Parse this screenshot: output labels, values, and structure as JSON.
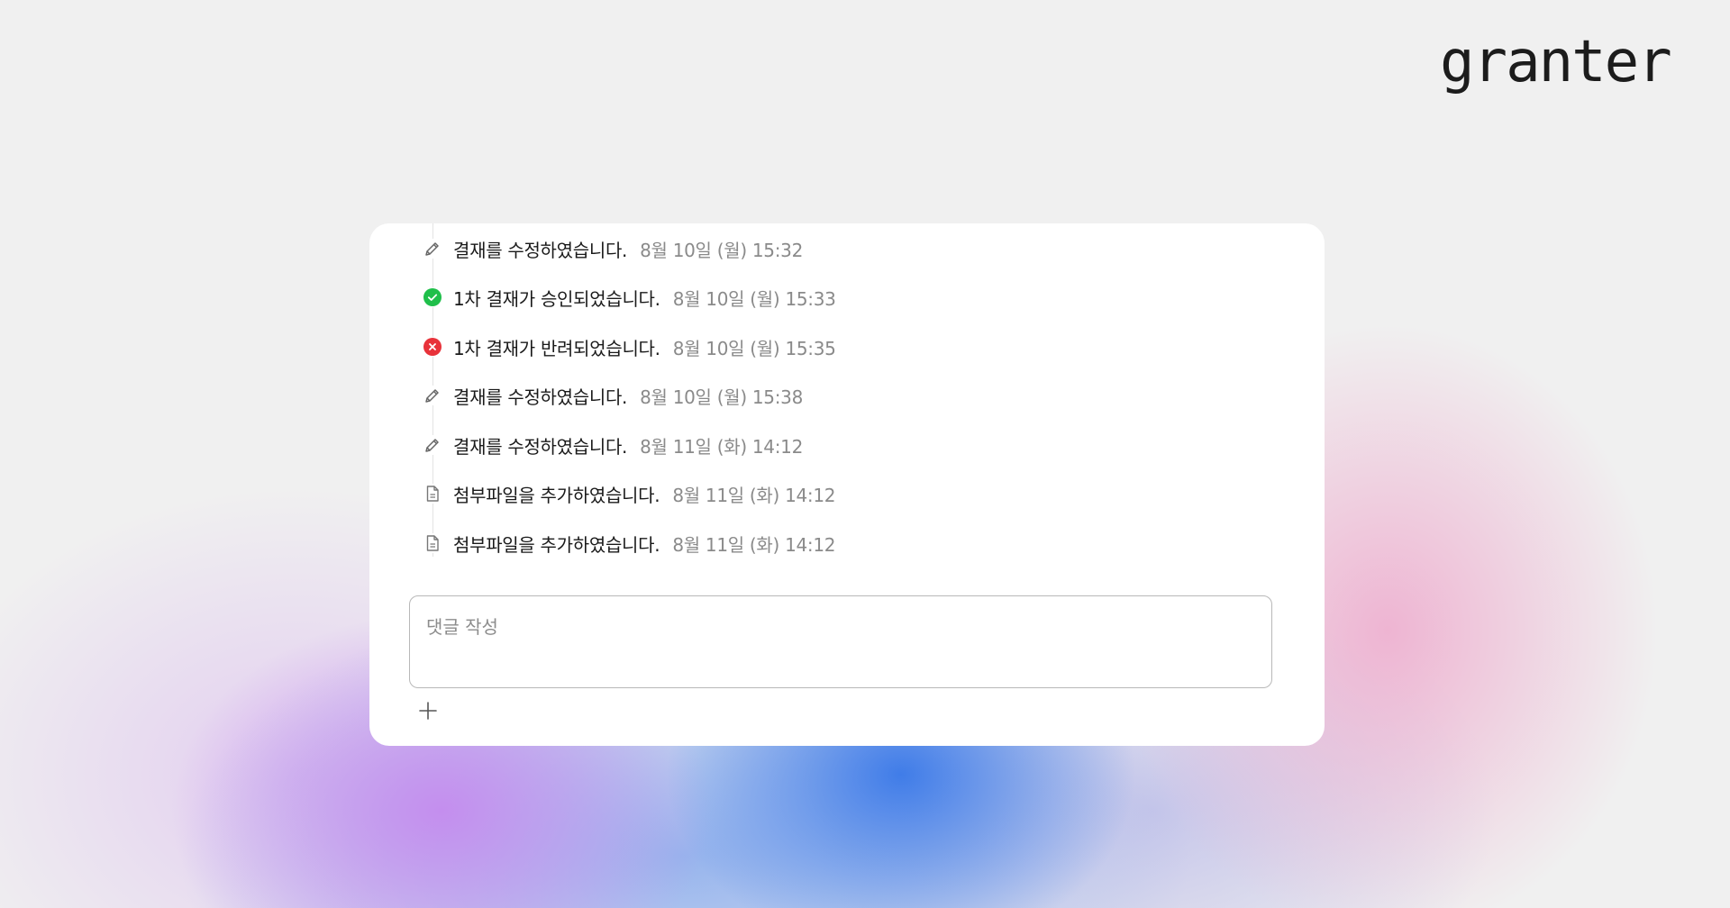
{
  "brand": {
    "logo_text": "granter"
  },
  "timeline": {
    "items": [
      {
        "icon": "pencil-icon",
        "text": "결재를 수정하였습니다.",
        "time": "8월 10일 (월) 15:32"
      },
      {
        "icon": "check-circle-icon",
        "text": "1차 결재가 승인되었습니다.",
        "time": "8월 10일 (월) 15:33",
        "color": "#1fbf4a"
      },
      {
        "icon": "x-circle-icon",
        "text": "1차 결재가 반려되었습니다.",
        "time": "8월 10일 (월) 15:35",
        "color": "#e8323a"
      },
      {
        "icon": "pencil-icon",
        "text": "결재를 수정하였습니다.",
        "time": "8월 10일 (월) 15:38"
      },
      {
        "icon": "pencil-icon",
        "text": "결재를 수정하였습니다.",
        "time": "8월 11일 (화) 14:12"
      },
      {
        "icon": "document-icon",
        "text": "첨부파일을 추가하였습니다.",
        "time": "8월 11일 (화) 14:12"
      },
      {
        "icon": "document-icon",
        "text": "첨부파일을 추가하였습니다.",
        "time": "8월 11일 (화) 14:12"
      }
    ]
  },
  "comment": {
    "placeholder": "댓글 작성",
    "value": ""
  },
  "add_button": {
    "icon": "plus-icon"
  },
  "colors": {
    "background": "#f0f0f0",
    "card": "#ffffff",
    "success": "#1fbf4a",
    "danger": "#e8323a",
    "text_primary": "#1a1a1a",
    "text_secondary": "#8a8a8a"
  }
}
